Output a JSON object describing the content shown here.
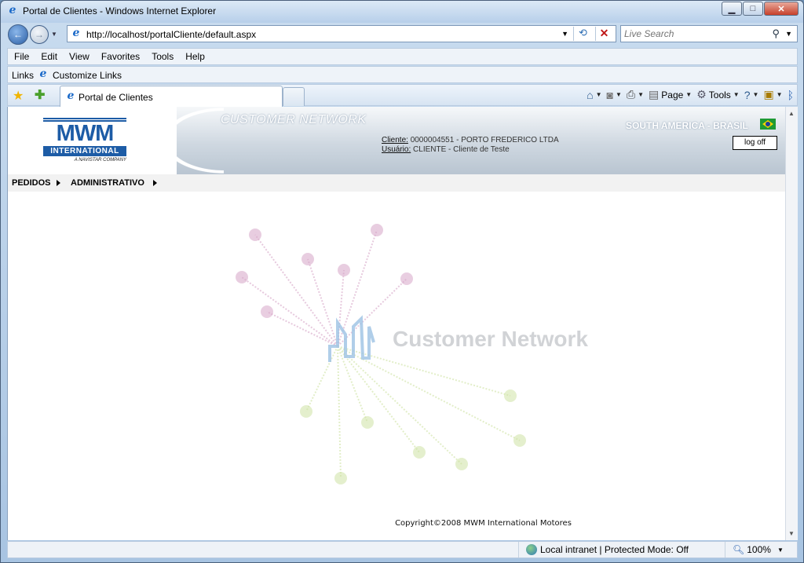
{
  "window": {
    "title": "Portal de Clientes - Windows Internet Explorer",
    "controls": [
      "minimize",
      "maximize",
      "close"
    ]
  },
  "address_bar": {
    "url": "http://localhost/portalCliente/default.aspx",
    "search_placeholder": "Live Search"
  },
  "menu": [
    "File",
    "Edit",
    "View",
    "Favorites",
    "Tools",
    "Help"
  ],
  "links_bar": {
    "label": "Links",
    "item": "Customize Links"
  },
  "tabs": {
    "active": "Portal de Clientes"
  },
  "command_bar": {
    "page": "Page",
    "tools": "Tools"
  },
  "page": {
    "brand": {
      "name": "MWM",
      "sub": "INTERNATIONAL",
      "tagline": "A NAVISTAR COMPANY"
    },
    "header_title": "CUSTOMER NETWORK",
    "cliente_label": "Cliente:",
    "cliente_value": "0000004551 - PORTO FREDERICO LTDA",
    "usuario_label": "Usuário:",
    "usuario_value": "CLIENTE - Cliente de Teste",
    "region": "SOUTH AMERICA - BRASIL",
    "logoff": "log off",
    "nav": [
      "PEDIDOS",
      "ADMINISTRATIVO"
    ],
    "watermark_text": "Customer Network",
    "footer": "Copyright©2008 MWM International Motores"
  },
  "status_bar": {
    "zone": "Local intranet | Protected Mode: Off",
    "zoom": "100%"
  },
  "colors": {
    "brand_blue": "#1d5ca6",
    "watermark_pink": "#d7a6c8",
    "watermark_green": "#cfe3a5",
    "watermark_blue": "#9cc2e3"
  }
}
